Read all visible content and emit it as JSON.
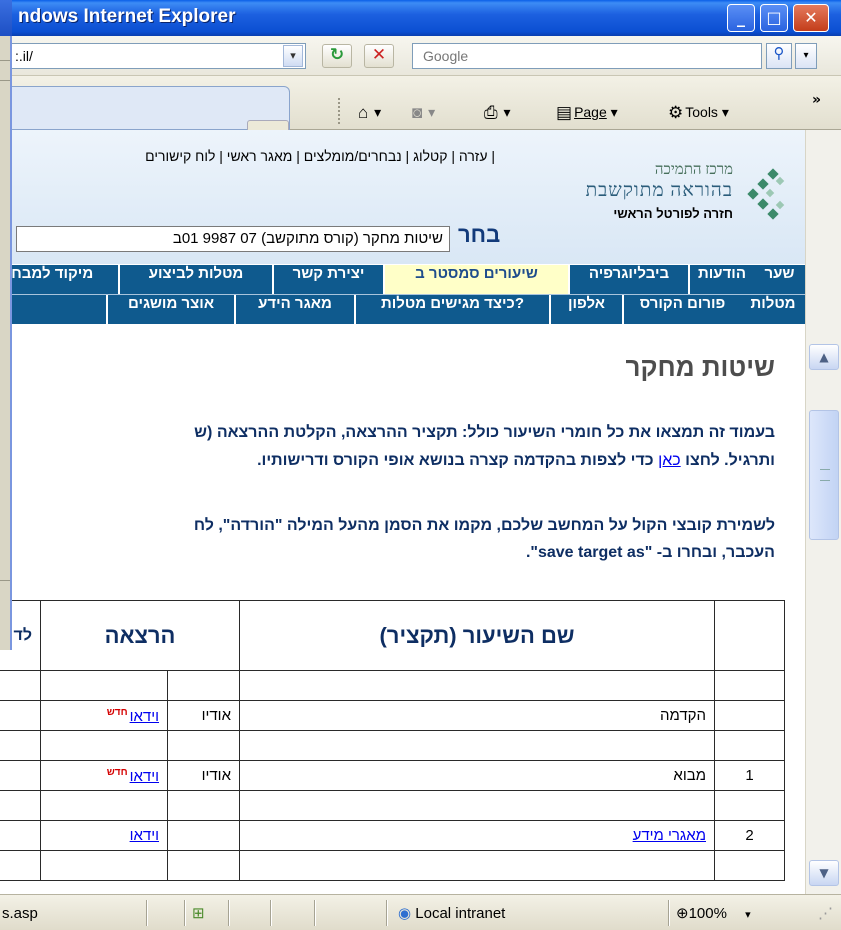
{
  "window": {
    "title": "ndows Internet Explorer",
    "controls": {
      "minimize": "_",
      "maximize": "□",
      "close": "✕"
    }
  },
  "address": {
    "value": ":.il/",
    "dropdown": "▾"
  },
  "search": {
    "placeholder": "Google",
    "button_icon": "search-icon",
    "dropdown": "▾"
  },
  "nav_buttons": {
    "refresh": "↻",
    "stop": "✕"
  },
  "toolbar": {
    "home_icon": "home-icon",
    "feeds_icon": "feeds-icon",
    "print_icon": "print-icon",
    "page_label": "Page",
    "tools_label": "Tools",
    "more": "»",
    "dropdown": "▾"
  },
  "site": {
    "top_links": "| עזרה | קטלוג | נבחרים/מומלצים | מאגר ראשי | לוח קישורים",
    "logo": {
      "line1": "מרכז התמיכה",
      "line2": "בהוראה מתוקשבת",
      "line3": "חזרה לפורטל הראשי"
    },
    "choose_label": "בחר",
    "course_select": "שיטות מחקר (קורס מתוקשב) 07 9987 01ב",
    "nav1": [
      {
        "label": "שער",
        "active": false
      },
      {
        "label": "הודעות",
        "active": false
      },
      {
        "label": "ביבליוגרפיה",
        "active": false
      },
      {
        "label": "שיעורים סמסטר ב",
        "active": true
      },
      {
        "label": "יצירת קשר",
        "active": false
      },
      {
        "label": "מטלות לביצוע",
        "active": false
      },
      {
        "label": "מיקוד למבחן",
        "active": false
      }
    ],
    "nav2": [
      {
        "label": "מטלות"
      },
      {
        "label": "פורום הקורס"
      },
      {
        "label": "אלפון"
      },
      {
        "label": "כיצד מגישים מטלות?"
      },
      {
        "label": "מאגר הידע"
      },
      {
        "label": "אוצר מושגים"
      }
    ]
  },
  "page": {
    "title": "שיטות מחקר",
    "para1_line1": "בעמוד זה תמצאו את כל חומרי השיעור כולל: תקציר ההרצאה, הקלטת ההרצאה (ש",
    "para1_line2_before": "ותרגיל. לחצו ",
    "para1_link": "כאן",
    "para1_line2_after": " כדי לצפות בהקדמה קצרה בנושא אופי הקורס ודרישותיו.",
    "para2_line1": "לשמירת קובצי הקול על המחשב שלכם, מקמו את הסמן מהעל המילה \"הורדה\", לח",
    "para2_line2": "העכבר, ובחרו ב- \"save target as\"."
  },
  "table": {
    "headers": {
      "name": "שם השיעור (תקציר)",
      "lecture": "הרצאה",
      "extra": "לד"
    },
    "rows": [
      {
        "num": "",
        "name": "הקדמה",
        "name_link": false,
        "audio": "אודיו",
        "video": "וידאו",
        "is_new": true
      },
      {
        "num": "1",
        "name": "מבוא",
        "name_link": false,
        "audio": "אודיו",
        "video": "וידאו",
        "is_new": true
      },
      {
        "num": "2",
        "name": "מאגרי מידע",
        "name_link": true,
        "audio": "",
        "video": "וידאו",
        "is_new": false
      }
    ],
    "new_badge": "חדש"
  },
  "statusbar": {
    "left": "s.asp",
    "zone": "Local intranet",
    "zoom": "100%",
    "zoom_dd": "▾"
  },
  "colors": {
    "nav_bg": "#0f5a8e",
    "nav_active_bg": "#ffffc8",
    "title_blue": "#0b4fd2",
    "text_navy": "#0e2e63"
  }
}
